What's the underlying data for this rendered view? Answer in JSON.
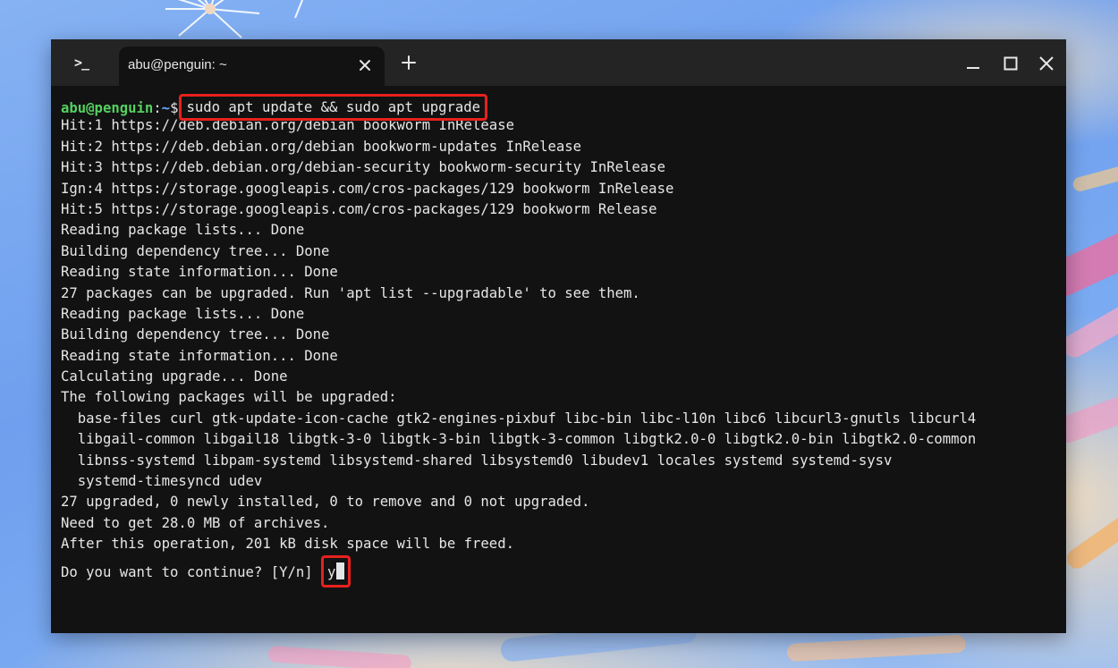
{
  "window": {
    "tab_title": "abu@penguin: ~",
    "icons": {
      "app": "terminal-icon",
      "tab_close": "close-icon",
      "new_tab": "plus-icon",
      "minimize": "minimize-icon",
      "maximize": "maximize-icon",
      "close": "close-icon"
    }
  },
  "prompt": {
    "user_host": "abu@penguin",
    "path_prefix": ":",
    "path": "~",
    "symbol": "$",
    "command": "sudo apt update && sudo apt upgrade"
  },
  "output": [
    "Hit:1 https://deb.debian.org/debian bookworm InRelease",
    "Hit:2 https://deb.debian.org/debian bookworm-updates InRelease",
    "Hit:3 https://deb.debian.org/debian-security bookworm-security InRelease",
    "Ign:4 https://storage.googleapis.com/cros-packages/129 bookworm InRelease",
    "Hit:5 https://storage.googleapis.com/cros-packages/129 bookworm Release",
    "Reading package lists... Done",
    "Building dependency tree... Done",
    "Reading state information... Done",
    "27 packages can be upgraded. Run 'apt list --upgradable' to see them.",
    "Reading package lists... Done",
    "Building dependency tree... Done",
    "Reading state information... Done",
    "Calculating upgrade... Done",
    "The following packages will be upgraded:",
    "  base-files curl gtk-update-icon-cache gtk2-engines-pixbuf libc-bin libc-l10n libc6 libcurl3-gnutls libcurl4",
    "  libgail-common libgail18 libgtk-3-0 libgtk-3-bin libgtk-3-common libgtk2.0-0 libgtk2.0-bin libgtk2.0-common",
    "  libnss-systemd libpam-systemd libsystemd-shared libsystemd0 libudev1 locales systemd systemd-sysv",
    "  systemd-timesyncd udev",
    "27 upgraded, 0 newly installed, 0 to remove and 0 not upgraded.",
    "Need to get 28.0 MB of archives.",
    "After this operation, 201 kB disk space will be freed."
  ],
  "question": {
    "text": "Do you want to continue? [Y/n] ",
    "answer": "y"
  },
  "colors": {
    "highlight": "#e8211c",
    "prompt_user": "#55d060",
    "prompt_path": "#6aa9ff",
    "terminal_bg": "#121212",
    "titlebar_bg": "#242424"
  }
}
